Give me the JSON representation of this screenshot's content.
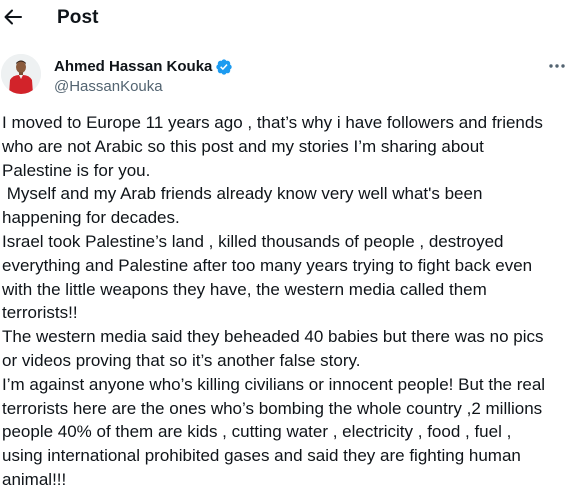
{
  "header": {
    "back_icon": "arrow-left-icon",
    "title": "Post"
  },
  "author": {
    "name": "Ahmed Hassan Kouka",
    "handle": "@HassanKouka",
    "verified_icon": "verified-badge-icon",
    "verified_color": "#1d9bf0",
    "more_icon": "more-horizontal-icon"
  },
  "post": {
    "lines": [
      "I moved to Europe 11 years ago , that’s why i have followers and friends",
      "who are not Arabic so this post and my stories I’m sharing about",
      "Palestine is for you.",
      " Myself and my Arab friends already know very well what's been",
      "happening for decades.",
      "Israel took Palestine’s land , killed thousands of people , destroyed",
      "everything and Palestine after too many years trying to fight back even",
      "with the little weapons they have, the western media called them",
      "terrorists!!",
      "The western media said they beheaded 40 babies but there was no pics",
      "or videos proving that so it’s another false story.",
      "I’m against anyone who’s killing civilians or innocent people! But the real",
      "terrorists here are the ones who’s bombing the whole country ,2 millions",
      "people 40% of them are kids , cutting water , electricity , food , fuel ,",
      "using international prohibited gases and said they are fighting human",
      "animal!!!"
    ]
  },
  "colors": {
    "text_primary": "#0f1419",
    "text_secondary": "#536471",
    "background": "#ffffff"
  }
}
